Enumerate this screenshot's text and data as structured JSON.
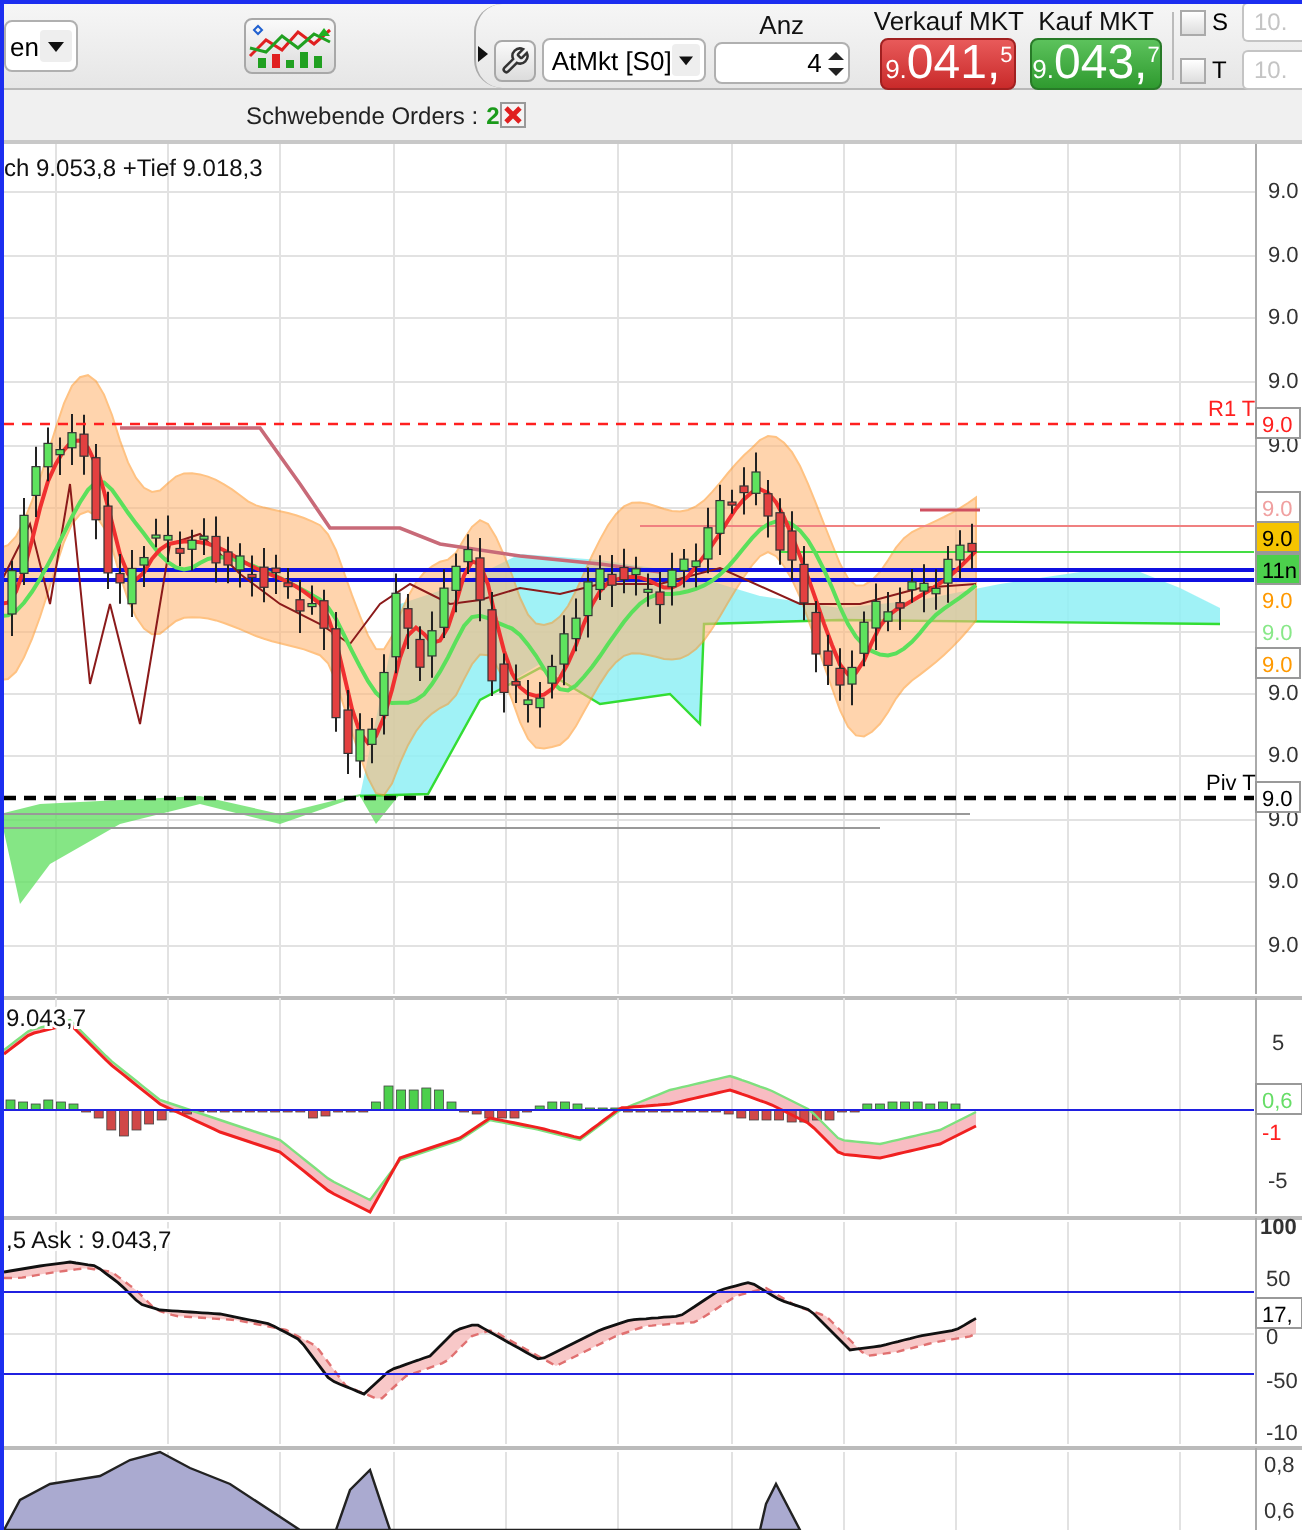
{
  "toolbar": {
    "period_select": {
      "value": "en"
    },
    "order_type_select": {
      "value": "AtMkt [S0]"
    },
    "quantity": {
      "label": "Anz",
      "value": "4"
    },
    "quotes": [
      {
        "kind": "sell",
        "label": "Verkauf MKT",
        "prefix": "9.",
        "main": "041,",
        "fraction": "5"
      },
      {
        "kind": "buy",
        "label": "Kauf MKT",
        "prefix": "9.",
        "main": "043,",
        "fraction": "7"
      }
    ],
    "options": [
      {
        "label": "S",
        "checked": false,
        "placeholder": "10."
      },
      {
        "label": "T",
        "checked": false,
        "placeholder": "10."
      }
    ]
  },
  "orders_bar": {
    "label": "Schwebende Orders :",
    "count": "2"
  },
  "price_panel": {
    "legend": "ch 9.053,8 +Tief 9.018,3",
    "axis_labels": [
      "9.0",
      "9.0",
      "9.0",
      "9.0",
      "9.0",
      "9.0",
      "9.0",
      "9.0",
      "9.0",
      "9.0"
    ],
    "level_lines": [
      {
        "kind": "resistance",
        "label": "R1 T"
      },
      {
        "kind": "pivot",
        "label": "Piv T"
      }
    ],
    "tags": [
      {
        "kind": "outlined",
        "text": "9.0",
        "color": "#ff2020"
      },
      {
        "kind": "outlined",
        "text": "9.0",
        "color": "#f0a0a0"
      },
      {
        "kind": "filled",
        "text": "9.0",
        "color": "#f5c400"
      },
      {
        "kind": "filled",
        "text": "11n",
        "color": "#4cd04c"
      },
      {
        "kind": "plain",
        "text": "9.0",
        "color": "#ff9900"
      },
      {
        "kind": "plain",
        "text": "9.0",
        "color": "#88e888"
      },
      {
        "kind": "outlined",
        "text": "9.0",
        "color": "#ff9900"
      },
      {
        "kind": "outlined",
        "text": "9.0",
        "color": "#000000"
      }
    ]
  },
  "macd_panel": {
    "legend": "9.043,7",
    "axis_labels": [
      "5",
      "-5"
    ],
    "tags": [
      {
        "kind": "outlined",
        "text": "0,6",
        "color": "#66dd66"
      },
      {
        "kind": "plain",
        "text": "-1",
        "color": "#ff2020"
      }
    ]
  },
  "stochastic_panel": {
    "legend": ",5 Ask : 9.043,7",
    "axis_labels": [
      "100",
      "50",
      "0",
      "-50",
      "-10"
    ],
    "tags": [
      {
        "kind": "outlined",
        "text": "17,",
        "color": "#000000"
      }
    ]
  },
  "volume_panel": {
    "axis_labels": [
      "0,8",
      "0,6"
    ]
  }
}
